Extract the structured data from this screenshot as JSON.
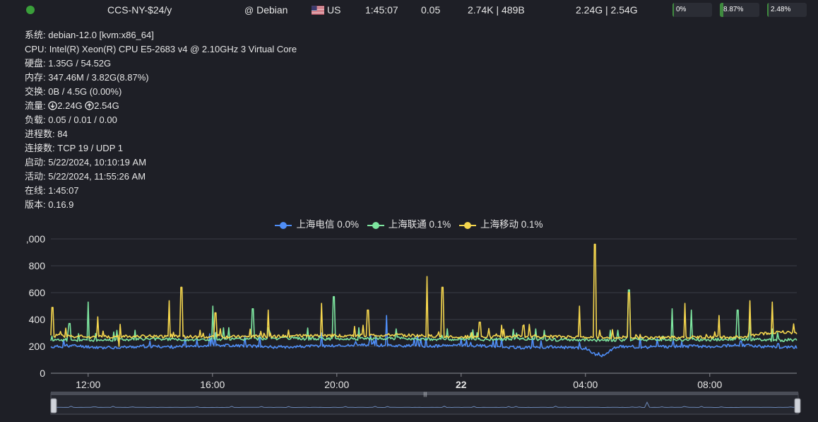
{
  "topbar": {
    "name": "CCS-NY-$24/y",
    "os": "Debian",
    "country": "US",
    "uptime": "1:45:07",
    "load": "0.05",
    "network_speed": "2.74K | 489B",
    "traffic": "2.24G | 2.54G",
    "meters": [
      {
        "label": "0%",
        "value": 0
      },
      {
        "label": "8.87%",
        "value": 8.87
      },
      {
        "label": "2.48%",
        "value": 2.48
      }
    ],
    "status_color": "#3a9f3a"
  },
  "details": [
    {
      "k": "系统",
      "v": "debian-12.0 [kvm:x86_64]"
    },
    {
      "k": "CPU",
      "v": "Intel(R) Xeon(R) CPU E5-2683 v4 @ 2.10GHz 3 Virtual Core"
    },
    {
      "k": "硬盘",
      "v": "1.35G / 54.52G"
    },
    {
      "k": "内存",
      "v": "347.46M / 3.82G(8.87%)"
    },
    {
      "k": "交换",
      "v": "0B / 4.5G (0.00%)"
    },
    {
      "k": "流量",
      "v_down": "2.24G",
      "v_up": "2.54G"
    },
    {
      "k": "负载",
      "v": "0.05 / 0.01 / 0.00"
    },
    {
      "k": "进程数",
      "v": "84"
    },
    {
      "k": "连接数",
      "v": "TCP 19 / UDP 1"
    },
    {
      "k": "启动",
      "v": "5/22/2024, 10:10:19 AM"
    },
    {
      "k": "活动",
      "v": "5/22/2024, 11:55:26 AM"
    },
    {
      "k": "在线",
      "v": "1:45:07"
    },
    {
      "k": "版本",
      "v": "0.16.9"
    }
  ],
  "chart_data": {
    "type": "line",
    "title": "",
    "xlabel": "",
    "ylabel": "",
    "ylim": [
      0,
      1000
    ],
    "y_ticks": [
      0,
      200,
      400,
      600,
      800,
      1000
    ],
    "y_tick_labels": [
      "0",
      "200",
      "400",
      "600",
      "800",
      ",000"
    ],
    "x_range_hours": [
      10.8,
      34.8
    ],
    "x_ticks": [
      {
        "hour": 12,
        "label": "12:00",
        "bold": false
      },
      {
        "hour": 16,
        "label": "16:00",
        "bold": false
      },
      {
        "hour": 20,
        "label": "20:00",
        "bold": false
      },
      {
        "hour": 24,
        "label": "22",
        "bold": true
      },
      {
        "hour": 28,
        "label": "04:00",
        "bold": false
      },
      {
        "hour": 32,
        "label": "08:00",
        "bold": false
      }
    ],
    "grid": true,
    "legend": "top-center",
    "series": [
      {
        "name": "上海电信",
        "legend_label": "上海电信 0.0%",
        "color": "#4f8ef7",
        "base": 200,
        "points": [
          [
            10.8,
            195
          ],
          [
            11.5,
            205
          ],
          [
            12.5,
            190
          ],
          [
            14,
            200
          ],
          [
            15,
            195
          ],
          [
            16,
            210
          ],
          [
            17,
            205
          ],
          [
            18,
            195
          ],
          [
            19,
            200
          ],
          [
            20,
            205
          ],
          [
            21,
            210
          ],
          [
            22,
            205
          ],
          [
            23,
            200
          ],
          [
            24,
            210
          ],
          [
            25,
            200
          ],
          [
            26,
            190
          ],
          [
            27,
            195
          ],
          [
            28,
            185
          ],
          [
            28.5,
            120
          ],
          [
            29,
            200
          ],
          [
            30,
            195
          ],
          [
            31,
            200
          ],
          [
            32,
            200
          ],
          [
            33,
            210
          ],
          [
            34,
            195
          ],
          [
            34.8,
            195
          ]
        ],
        "spikes": [
          [
            11.2,
            250
          ],
          [
            15.5,
            250
          ],
          [
            19.5,
            300
          ],
          [
            21.6,
            430
          ],
          [
            22.7,
            260
          ],
          [
            25.3,
            260
          ],
          [
            27.8,
            230
          ],
          [
            30.3,
            260
          ],
          [
            31.5,
            210
          ],
          [
            33.0,
            240
          ],
          [
            34.2,
            220
          ]
        ]
      },
      {
        "name": "上海联通",
        "legend_label": "上海联通 0.1%",
        "color": "#7ee6a0",
        "base": 250,
        "points": [
          [
            10.8,
            250
          ],
          [
            12,
            245
          ],
          [
            14,
            255
          ],
          [
            16,
            250
          ],
          [
            18,
            260
          ],
          [
            20,
            255
          ],
          [
            22,
            260
          ],
          [
            24,
            250
          ],
          [
            26,
            255
          ],
          [
            28,
            245
          ],
          [
            30,
            250
          ],
          [
            32,
            250
          ],
          [
            33,
            255
          ],
          [
            34.2,
            245
          ],
          [
            34.8,
            250
          ]
        ],
        "spikes": [
          [
            11.4,
            370
          ],
          [
            12.0,
            530
          ],
          [
            13.5,
            320
          ],
          [
            16.0,
            500
          ],
          [
            17.3,
            480
          ],
          [
            19.9,
            570
          ],
          [
            21.9,
            330
          ],
          [
            24.3,
            300
          ],
          [
            26.4,
            330
          ],
          [
            28.8,
            320
          ],
          [
            29.4,
            620
          ],
          [
            30.8,
            480
          ],
          [
            31.4,
            470
          ],
          [
            32.9,
            470
          ],
          [
            33.3,
            430
          ],
          [
            34.0,
            330
          ]
        ]
      },
      {
        "name": "上海移动",
        "legend_label": "上海移动 0.1%",
        "color": "#f5d64e",
        "base": 270,
        "points": [
          [
            10.8,
            280
          ],
          [
            12,
            270
          ],
          [
            14,
            275
          ],
          [
            16,
            270
          ],
          [
            18,
            275
          ],
          [
            20,
            280
          ],
          [
            22,
            285
          ],
          [
            24,
            270
          ],
          [
            26,
            275
          ],
          [
            28,
            270
          ],
          [
            30,
            265
          ],
          [
            32,
            270
          ],
          [
            33,
            270
          ],
          [
            34.2,
            310
          ],
          [
            34.8,
            300
          ]
        ],
        "spikes": [
          [
            10.85,
            490
          ],
          [
            12.3,
            420
          ],
          [
            13.0,
            200
          ],
          [
            14.6,
            540
          ],
          [
            15.0,
            640
          ],
          [
            16.1,
            450
          ],
          [
            17.8,
            470
          ],
          [
            19.5,
            520
          ],
          [
            21.0,
            470
          ],
          [
            22.9,
            720
          ],
          [
            23.4,
            640
          ],
          [
            24.6,
            380
          ],
          [
            27.8,
            500
          ],
          [
            28.3,
            960
          ],
          [
            29.4,
            600
          ],
          [
            31.2,
            520
          ],
          [
            32.3,
            430
          ],
          [
            33.3,
            540
          ],
          [
            34.0,
            530
          ]
        ]
      }
    ]
  },
  "brush": {
    "handle_label": "|||"
  }
}
